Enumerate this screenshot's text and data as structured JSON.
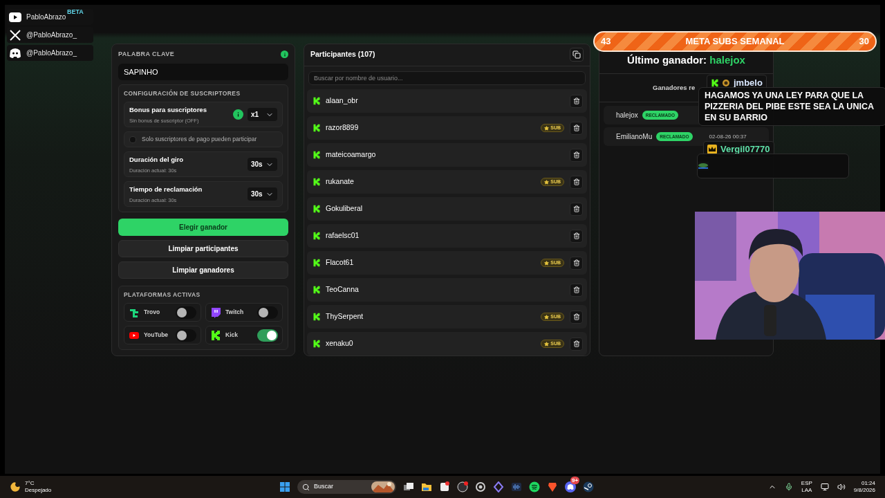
{
  "brand": {
    "badge": "BETA"
  },
  "socials": [
    {
      "kind": "youtube",
      "handle": "PabloAbrazo"
    },
    {
      "kind": "x",
      "handle": "@PabloAbrazo_"
    },
    {
      "kind": "discord",
      "handle": "@PabloAbrazo_"
    }
  ],
  "keyword": {
    "label": "PALABRA CLAVE",
    "value": "SAPINHO"
  },
  "subscriber_config": {
    "title": "CONFIGURACIÓN DE SUSCRIPTORES",
    "bonus": {
      "label": "Bonus para suscriptores",
      "hint": "Sin bonus de suscriptor (OFF)",
      "value": "x1"
    },
    "paid_only": {
      "label": "Solo suscriptores de pago pueden participar",
      "checked": false
    },
    "settings": [
      {
        "label": "Duración del giro",
        "hint": "Duración actual: 30s",
        "value": "30s"
      },
      {
        "label": "Tiempo de reclamación",
        "hint": "Duración actual: 30s",
        "value": "30s"
      }
    ]
  },
  "actions": [
    {
      "label": "Elegir ganador",
      "kind": "primary"
    },
    {
      "label": "Limpiar participantes",
      "kind": "secondary"
    },
    {
      "label": "Limpiar ganadores",
      "kind": "secondary"
    }
  ],
  "platforms": {
    "title": "PLATAFORMAS ACTIVAS",
    "items": [
      {
        "kind": "trovo",
        "name": "Trovo",
        "on": false
      },
      {
        "kind": "twitch",
        "name": "Twitch",
        "on": false
      },
      {
        "kind": "youtube",
        "name": "YouTube",
        "on": false
      },
      {
        "kind": "kick",
        "name": "Kick",
        "on": true
      }
    ]
  },
  "participants": {
    "title": "Participantes (107)",
    "search_placeholder": "Buscar por nombre de usuario...",
    "rows": [
      {
        "name": "alaan_obr"
      },
      {
        "name": "razor8899",
        "badge": "SUB"
      },
      {
        "name": "mateicoamargo"
      },
      {
        "name": "rukanate",
        "badge": "SUB"
      },
      {
        "name": "Gokuliberal"
      },
      {
        "name": "rafaelsc01"
      },
      {
        "name": "Flacot61",
        "badge": "SUB"
      },
      {
        "name": "TeoCanna"
      },
      {
        "name": "ThySerpent",
        "badge": "SUB"
      },
      {
        "name": "xenaku0",
        "badge": "SUB"
      }
    ]
  },
  "winners": {
    "last_label": "Último ganador:",
    "last_name": "halejox",
    "recent_title": "Ganadores re",
    "rows": [
      {
        "name": "halejox",
        "status": "RECLAMADO"
      },
      {
        "name": "EmilianoMu",
        "status": "RECLAMADO",
        "date": "02-08-26 00:37"
      }
    ]
  },
  "sub_goal": {
    "current": "43",
    "title": "META SUBS SEMANAL",
    "goal": "30"
  },
  "chat": [
    {
      "user": "jmbelo",
      "kind": "kick",
      "message": "HAGAMOS YA UNA LEY PARA QUE LA PIZZERIA DEL PIBE ESTE SEA LA UNICA EN SU BARRIO"
    },
    {
      "user": "Vergil07770",
      "kind": "crown"
    }
  ],
  "taskbar": {
    "temp": "7°C",
    "weather": "Despejado",
    "search": "Buscar",
    "discord_badge": "9+",
    "lang": "ESP",
    "layout": "LAA",
    "time": "01:24",
    "date": "9/8/2026"
  }
}
